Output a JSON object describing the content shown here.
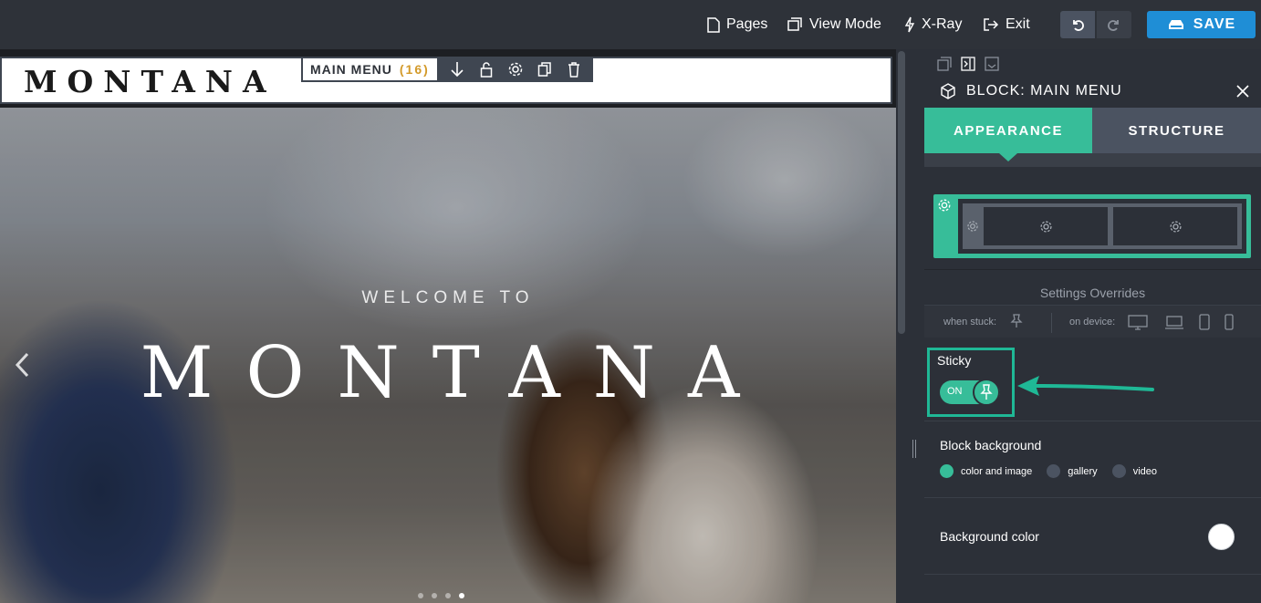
{
  "topbar": {
    "pages": "Pages",
    "view_mode": "View Mode",
    "xray": "X-Ray",
    "exit": "Exit",
    "save": "SAVE"
  },
  "editor": {
    "logo": "MONTANA",
    "block_label": "MAIN MENU",
    "block_count": "(16)",
    "hero_welcome": "WELCOME TO",
    "hero_title": "MONTANA"
  },
  "panel": {
    "title": "BLOCK: MAIN MENU",
    "tabs": [
      "APPEARANCE",
      "STRUCTURE"
    ],
    "overrides_title": "Settings Overrides",
    "when_stuck": "when stuck:",
    "on_device": "on device:",
    "sticky_label": "Sticky",
    "sticky_state": "ON",
    "block_background": "Block background",
    "bg_options": [
      "color and image",
      "gallery",
      "video"
    ],
    "background_color": "Background color"
  },
  "colors": {
    "accent": "#37bd99",
    "save": "#1f8ed6",
    "panel_bg": "#2c3038"
  }
}
